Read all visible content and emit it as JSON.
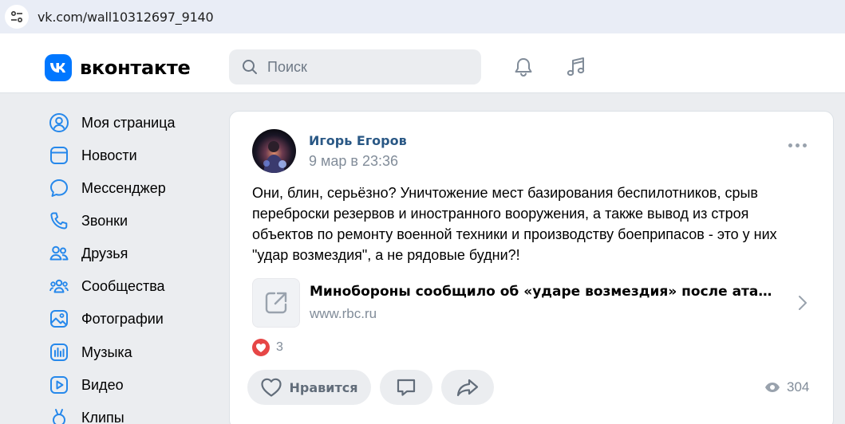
{
  "browser": {
    "url": "vk.com/wall10312697_9140"
  },
  "header": {
    "logo_text": "вконтакте",
    "search_placeholder": "Поиск",
    "notifications_icon": "bell-icon",
    "music_icon": "music-note-icon"
  },
  "sidebar": {
    "items": [
      {
        "label": "Моя страница",
        "icon": "user-circle-icon"
      },
      {
        "label": "Новости",
        "icon": "newsfeed-icon"
      },
      {
        "label": "Мессенджер",
        "icon": "message-icon"
      },
      {
        "label": "Звонки",
        "icon": "phone-icon"
      },
      {
        "label": "Друзья",
        "icon": "users-icon"
      },
      {
        "label": "Сообщества",
        "icon": "communities-icon"
      },
      {
        "label": "Фотографии",
        "icon": "photo-icon"
      },
      {
        "label": "Музыка",
        "icon": "music-bars-icon"
      },
      {
        "label": "Видео",
        "icon": "video-icon"
      },
      {
        "label": "Клипы",
        "icon": "clips-icon"
      }
    ]
  },
  "post": {
    "author": "Игорь Егоров",
    "date": "9 мар в 23:36",
    "text": "Они, блин, серьёзно? Уничтожение мест базирования беспилотников, срыв переброски резервов и иностранного вооружения, а также вывод из строя объектов по ремонту военной техники и производству боеприпасов - это у них \"удар возмездия\", а не рядовые будни?!",
    "link": {
      "title": "Минобороны сообщило об «ударе возмездия» после атаки в Б…",
      "domain": "www.rbc.ru"
    },
    "reactions_count": "3",
    "like_label": "Нравится",
    "views": "304"
  },
  "colors": {
    "brand": "#0077ff",
    "author_link": "#2a5885",
    "secondary_text": "#818c99",
    "reaction_red": "#e64646"
  }
}
